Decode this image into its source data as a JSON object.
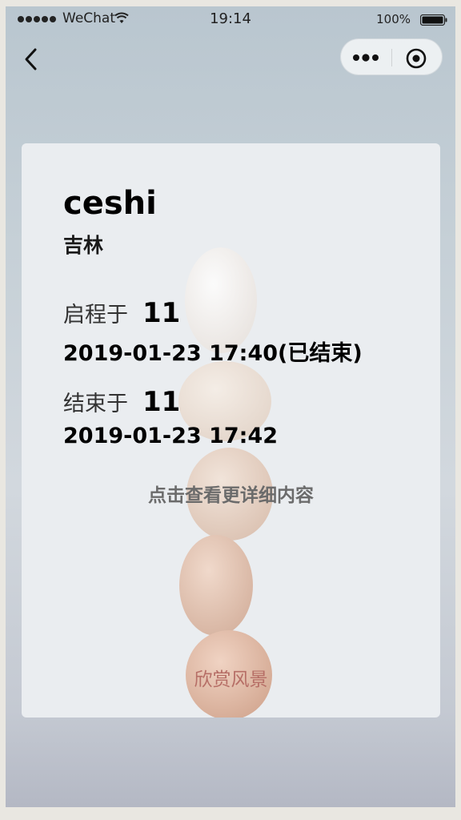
{
  "status_bar": {
    "carrier": "WeChat",
    "time": "19:14",
    "battery": "100%"
  },
  "card": {
    "title": "ceshi",
    "subtitle": "吉林",
    "start": {
      "label": "启程于",
      "value": "11",
      "time": "2019-01-23 17:40(已结束)"
    },
    "end": {
      "label": "结束于",
      "value": "11",
      "time": "2019-01-23 17:42"
    },
    "detail_link": "点击查看更详细内容",
    "scenery_link": "欣赏风景"
  }
}
